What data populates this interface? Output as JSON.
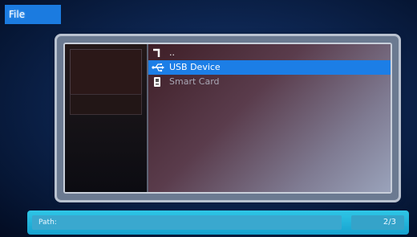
{
  "menu": {
    "file_label": "File"
  },
  "browser": {
    "items": [
      {
        "label": "..",
        "icon": "return-arrow-icon",
        "selected": false
      },
      {
        "label": "USB Device",
        "icon": "usb-icon",
        "selected": true
      },
      {
        "label": "Smart Card",
        "icon": "smart-card-icon",
        "selected": false
      }
    ]
  },
  "status": {
    "path_label": "Path:",
    "page": "2/3"
  },
  "colors": {
    "selection": "#1c7ee6",
    "status_bar": "#1fb3da",
    "tab": "#1b7be0"
  }
}
